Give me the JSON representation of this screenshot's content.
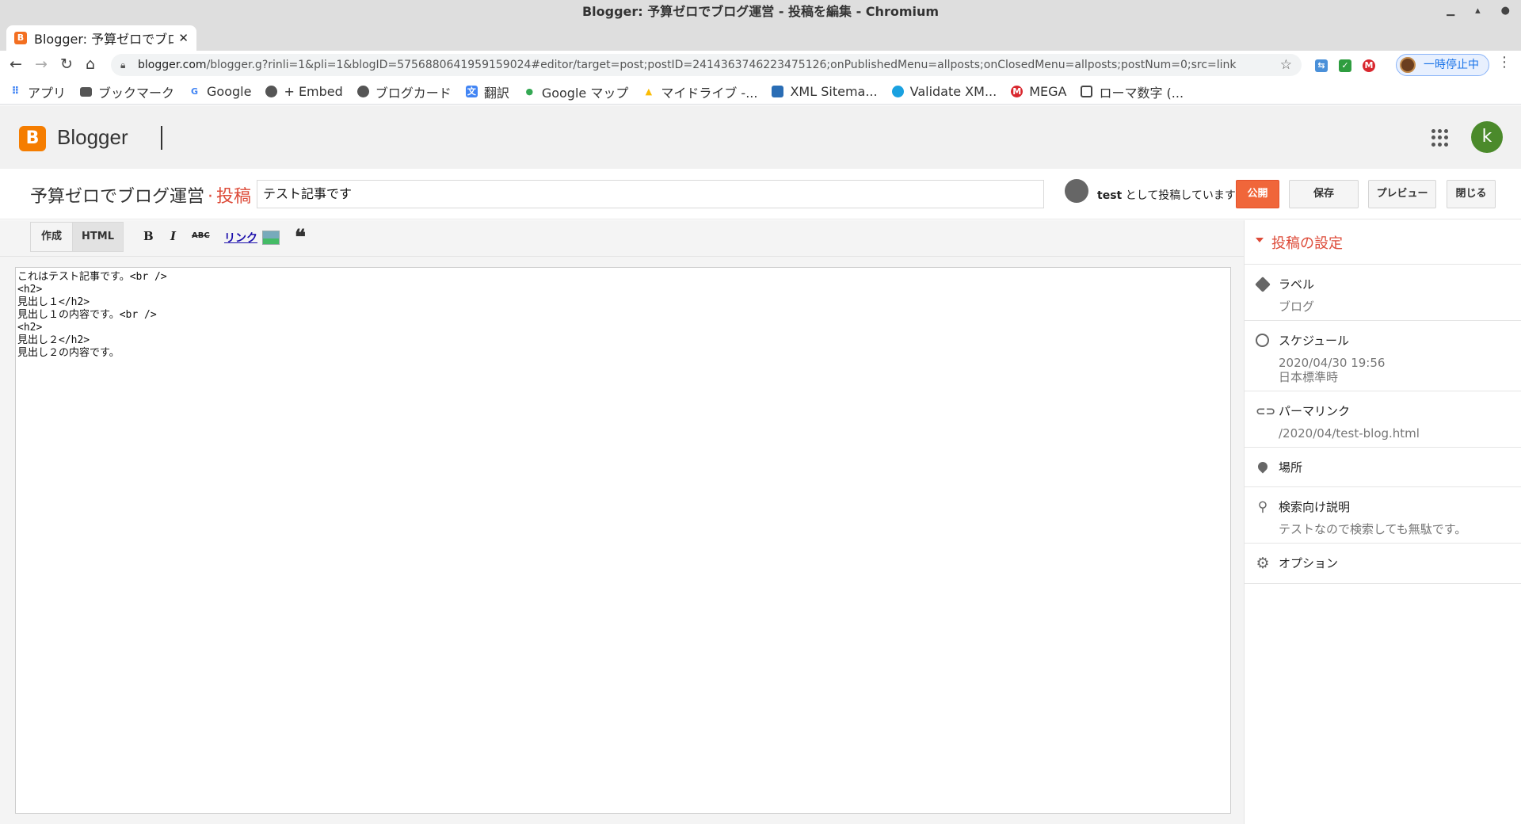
{
  "window": {
    "title": "Blogger: 予算ゼロでブログ運営 - 投稿を編集 - Chromium"
  },
  "browser": {
    "tab_title": "Blogger: 予算ゼロでブロ",
    "url_host": "blogger.com",
    "url_path": "/blogger.g?rinli=1&pli=1&blogID=5756880641959159024#editor/target=post;postID=2414363746223475126;onPublishedMenu=allposts;onClosedMenu=allposts;postNum=0;src=link",
    "profile_status": "一時停止中"
  },
  "bookmarks": [
    {
      "label": "アプリ",
      "icon": "apps-icon"
    },
    {
      "label": "ブックマーク",
      "icon": "folder-icon"
    },
    {
      "label": "Google",
      "icon": "google-icon"
    },
    {
      "label": "+ Embed",
      "icon": "globe-icon"
    },
    {
      "label": "ブログカード",
      "icon": "globe-icon"
    },
    {
      "label": "翻訳",
      "icon": "translate-icon"
    },
    {
      "label": "Google マップ",
      "icon": "maps-icon"
    },
    {
      "label": "マイドライブ -...",
      "icon": "drive-icon"
    },
    {
      "label": "XML Sitema...",
      "icon": "sitemap-icon"
    },
    {
      "label": "Validate XM...",
      "icon": "globe-icon"
    },
    {
      "label": "MEGA",
      "icon": "mega-icon"
    },
    {
      "label": "ローマ数字 (...",
      "icon": "doc-icon"
    }
  ],
  "app": {
    "brand": "Blogger",
    "logo_letter": "B",
    "user_initial": "k"
  },
  "post_header": {
    "blog_name": "予算ゼロでブログ運営",
    "separator": "·",
    "section": "投稿",
    "title_value": "テスト記事です",
    "author_name": "test",
    "author_suffix": " として投稿しています",
    "publish_label": "公開",
    "save_label": "保存",
    "preview_label": "プレビュー",
    "close_label": "閉じる"
  },
  "editor_toolbar": {
    "compose_label": "作成",
    "html_label": "HTML",
    "bold": "B",
    "italic": "I",
    "strike": "ABC",
    "link": "リンク",
    "quote": "❝"
  },
  "editor": {
    "content": "これはテスト記事です。<br />\n<h2>\n見出し１</h2>\n見出し１の内容です。<br />\n<h2>\n見出し２</h2>\n見出し２の内容です。"
  },
  "sidebar": {
    "heading": "投稿の設定",
    "label_title": "ラベル",
    "label_value": "ブログ",
    "schedule_title": "スケジュール",
    "schedule_date": "2020/04/30 19:56",
    "schedule_tz": "日本標準時",
    "permalink_title": "パーマリンク",
    "permalink_value": "/2020/04/test-blog.html",
    "location_title": "場所",
    "search_desc_title": "検索向け説明",
    "search_desc_value": "テストなので検索しても無駄です。",
    "options_title": "オプション"
  },
  "colors": {
    "accent": "#dd4b39",
    "publish": "#f0663a",
    "blogger_orange": "#f57d00"
  }
}
